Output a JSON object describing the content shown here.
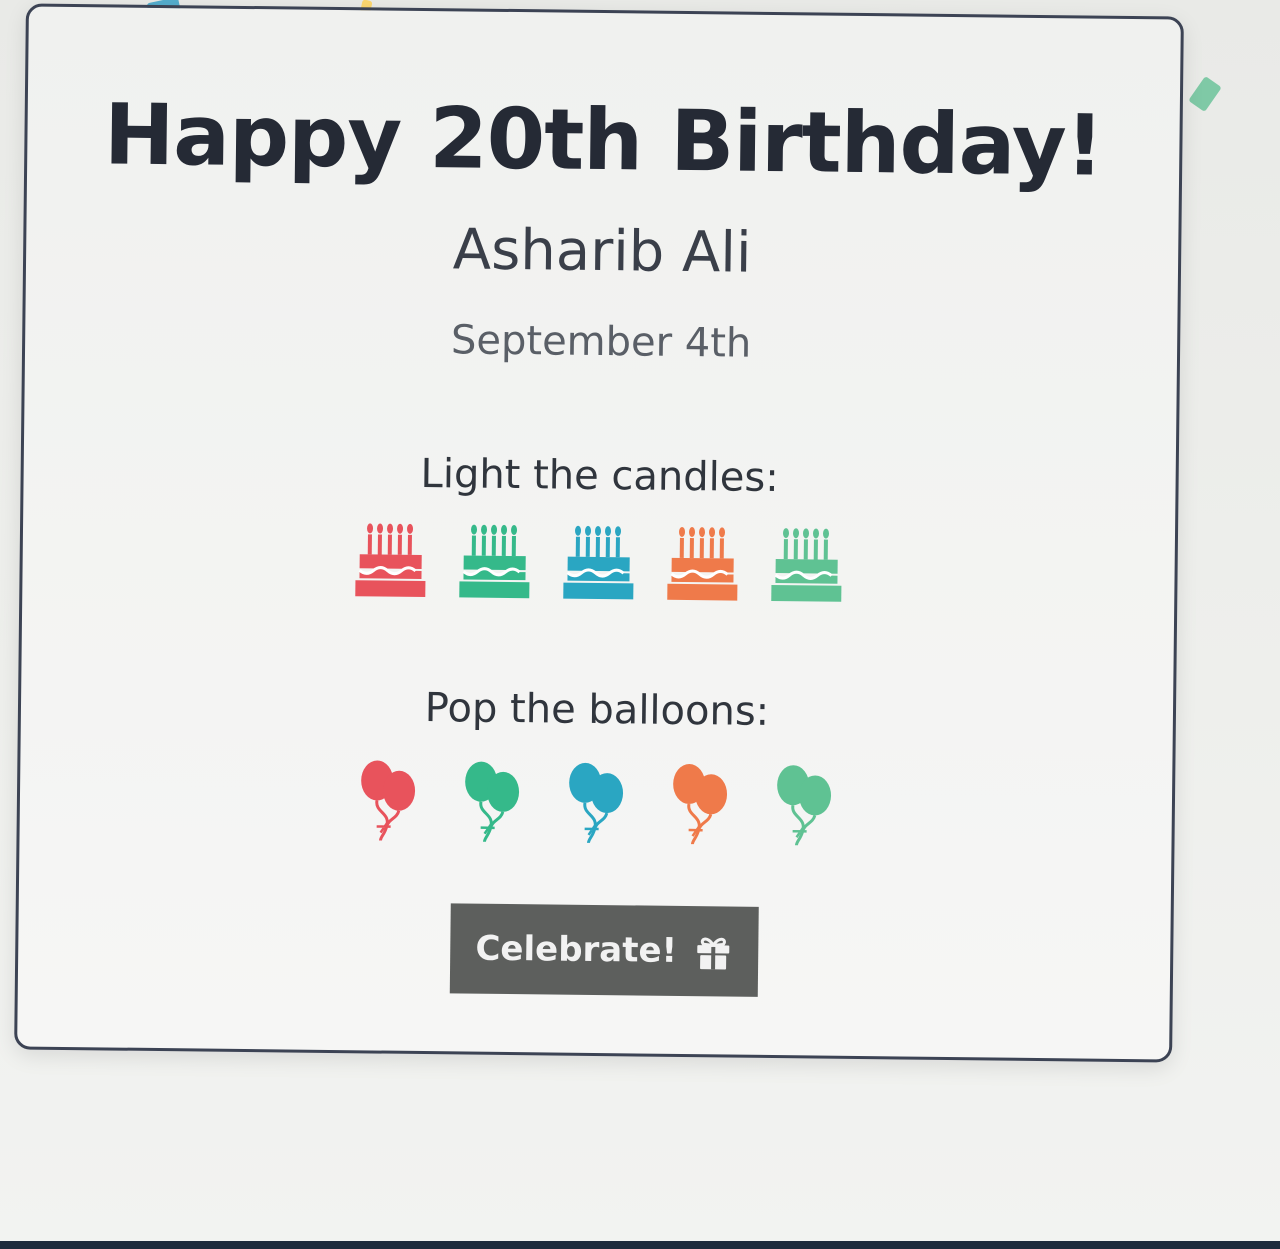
{
  "card": {
    "title": "Happy 20th Birthday!",
    "name": "Asharib Ali",
    "date": "September 4th"
  },
  "candles": {
    "label": "Light the candles:",
    "cakes": [
      {
        "color": "#e8535c",
        "icon": "birthday-cake-icon"
      },
      {
        "color": "#35b98a",
        "icon": "birthday-cake-icon"
      },
      {
        "color": "#2aa6c2",
        "icon": "birthday-cake-icon"
      },
      {
        "color": "#ef7a4a",
        "icon": "birthday-cake-icon"
      },
      {
        "color": "#5fc293",
        "icon": "birthday-cake-icon"
      }
    ]
  },
  "balloons": {
    "label": "Pop the balloons:",
    "items": [
      {
        "color": "#e8535c",
        "icon": "balloons-icon"
      },
      {
        "color": "#35b98a",
        "icon": "balloons-icon"
      },
      {
        "color": "#2aa6c2",
        "icon": "balloons-icon"
      },
      {
        "color": "#ef7a4a",
        "icon": "balloons-icon"
      },
      {
        "color": "#5fc293",
        "icon": "balloons-icon"
      }
    ]
  },
  "button": {
    "label": "Celebrate!",
    "icon": "gift-icon",
    "background": "#5d5f5d"
  },
  "confetti_colors": [
    "#a889d6",
    "#6cc39a",
    "#3aa3c9",
    "#e88a6a",
    "#ffd35a"
  ]
}
